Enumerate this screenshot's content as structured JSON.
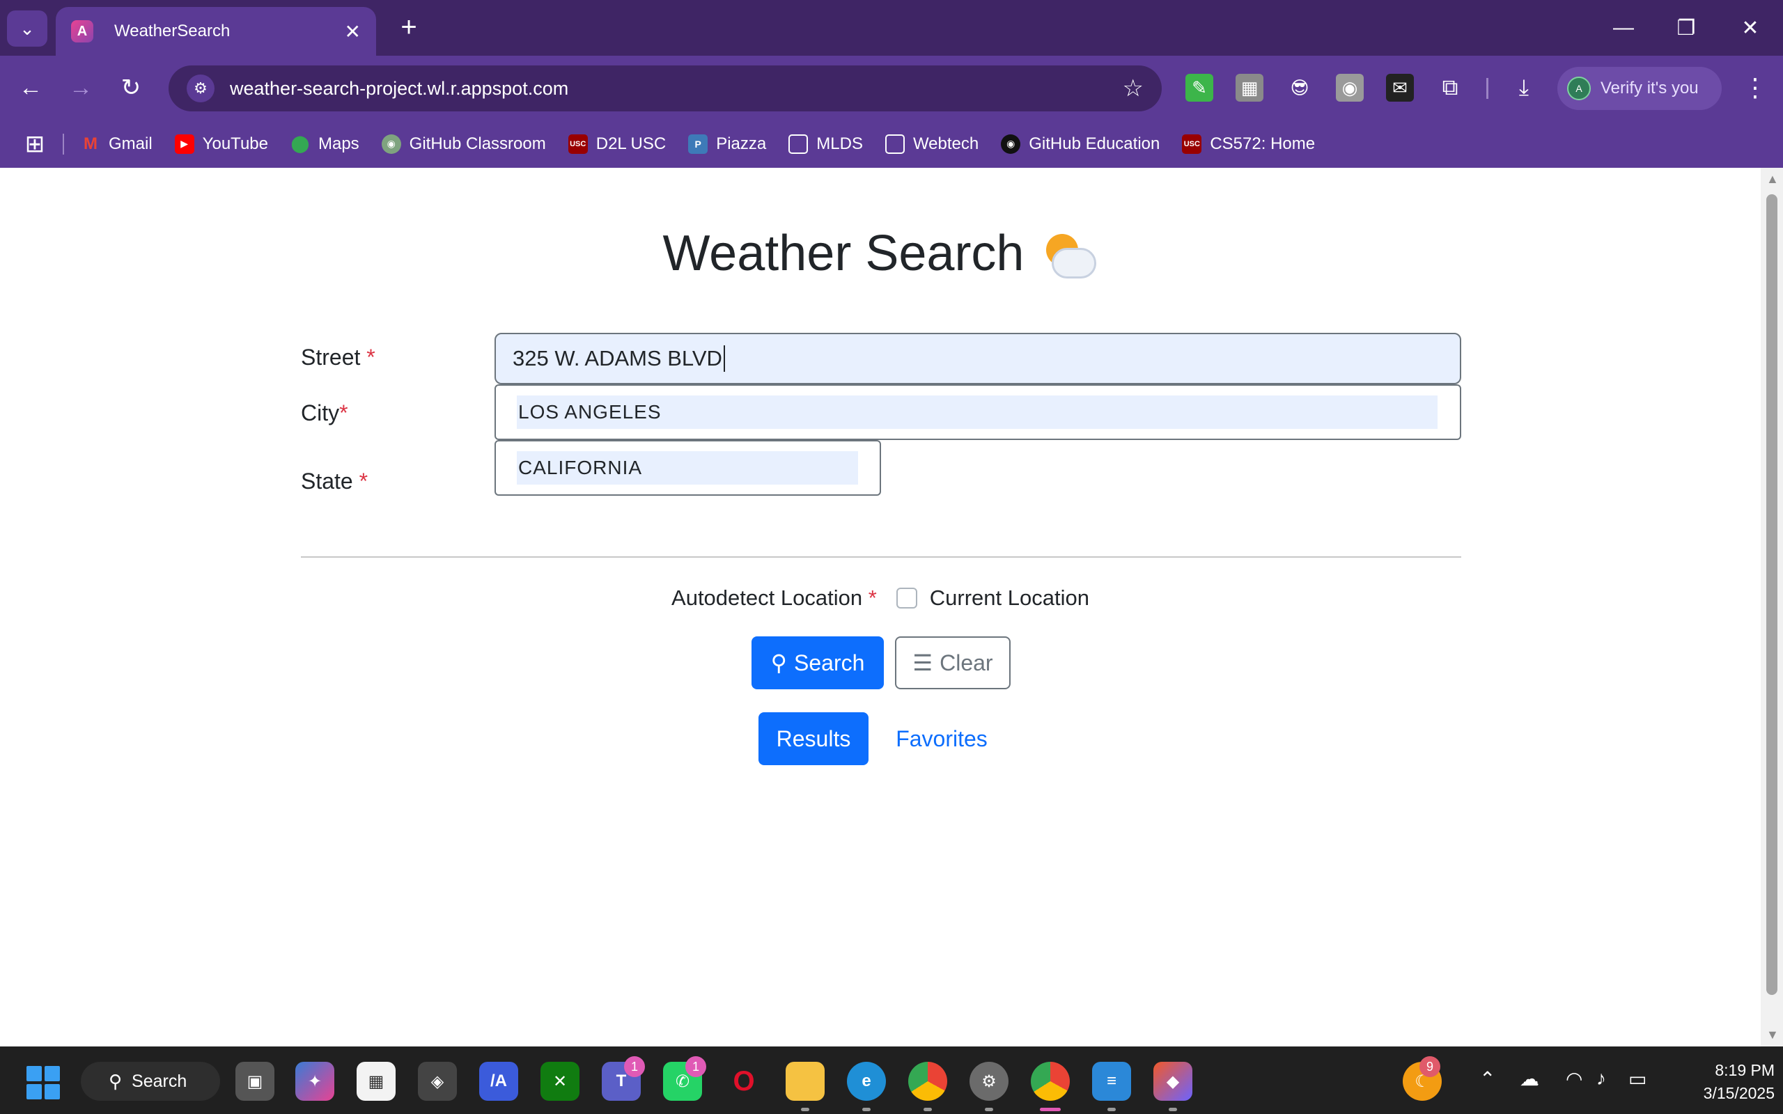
{
  "browser": {
    "tab_title": "WeatherSearch",
    "url": "weather-search-project.wl.r.appspot.com",
    "profile_label": "Verify it's you",
    "profile_initial": "A",
    "bookmarks": [
      {
        "label": "Gmail",
        "icon": "gmail-icon",
        "color": "#ea4335"
      },
      {
        "label": "YouTube",
        "icon": "youtube-icon",
        "color": "#ff0000"
      },
      {
        "label": "Maps",
        "icon": "maps-icon",
        "color": "#34a853"
      },
      {
        "label": "GitHub Classroom",
        "icon": "github-icon",
        "color": "#7fa37f"
      },
      {
        "label": "D2L USC",
        "icon": "usc-icon",
        "color": "#990000"
      },
      {
        "label": "Piazza",
        "icon": "piazza-icon",
        "color": "#3e7ab8"
      },
      {
        "label": "MLDS",
        "icon": "folder-icon",
        "color": ""
      },
      {
        "label": "Webtech",
        "icon": "folder-icon",
        "color": ""
      },
      {
        "label": "GitHub Education",
        "icon": "github-icon",
        "color": "#111111"
      },
      {
        "label": "CS572: Home",
        "icon": "usc-icon",
        "color": "#990000"
      }
    ]
  },
  "page": {
    "title": "Weather Search",
    "form": {
      "street_label": "Street",
      "street_value": "325 W. ADAMS BLVD",
      "city_label": "City",
      "city_suggestion": "LOS ANGELES",
      "state_label": "State",
      "state_suggestion": "CALIFORNIA",
      "required_mark": "*",
      "autodetect_label": "Autodetect Location",
      "current_location_label": "Current Location",
      "current_location_checked": false
    },
    "buttons": {
      "search": "Search",
      "clear": "Clear",
      "results": "Results",
      "favorites": "Favorites"
    },
    "colors": {
      "primary": "#0d6efd",
      "required": "#dc3545",
      "autofill": "#e8f0fe"
    }
  },
  "taskbar": {
    "search_label": "Search",
    "teams_badge": "1",
    "whatsapp_badge": "1",
    "weather_badge": "9",
    "time": "8:19 PM",
    "date": "3/15/2025"
  }
}
